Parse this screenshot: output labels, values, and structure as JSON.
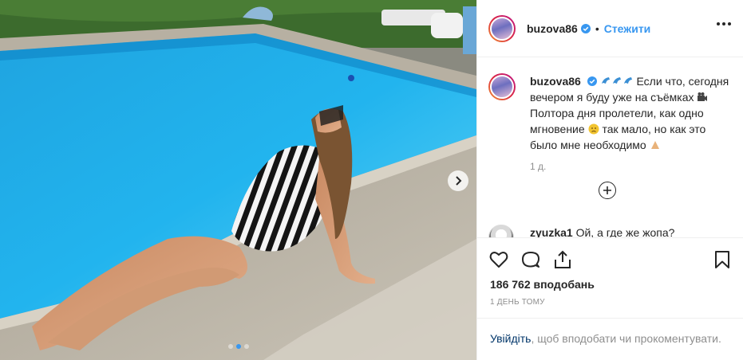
{
  "post": {
    "author": "buzova86",
    "follow_label": "Стежити",
    "separator": "•",
    "caption_text_1": "Если что, сегодня вечером я буду уже на съёмках",
    "caption_text_2": "Полтора дня пролетели, как одно мгновение",
    "caption_text_3": "так мало, но как это было мне необходимо",
    "caption_age": "1 д.",
    "comment": {
      "user": "zyuzka1",
      "text": "Ой, а где же жопа?"
    },
    "likes": "186 762 вподобань",
    "posted_ago": "1 ДЕНЬ ТОМУ",
    "login_link": "Увійдіть",
    "login_rest": ", щоб вподобати чи прокоментувати."
  },
  "icons": {
    "verified": "verified-badge-icon",
    "more": "more-options-icon",
    "heart": "heart-icon",
    "comment": "comment-icon",
    "share": "share-icon",
    "save": "bookmark-icon",
    "load_more": "plus-circle-icon",
    "next": "chevron-right-icon",
    "caption_emoji_1": "dolphin-emoji",
    "caption_emoji_2": "movie-camera-emoji",
    "caption_emoji_3": "disappointed-face-emoji",
    "caption_emoji_4": "folded-hands-emoji"
  },
  "carousel": {
    "total_slides": 3,
    "active_slide": 2
  },
  "colors": {
    "accent": "#3897f0",
    "text": "#262626",
    "muted": "#8e8e8e",
    "login_link": "#003569"
  }
}
